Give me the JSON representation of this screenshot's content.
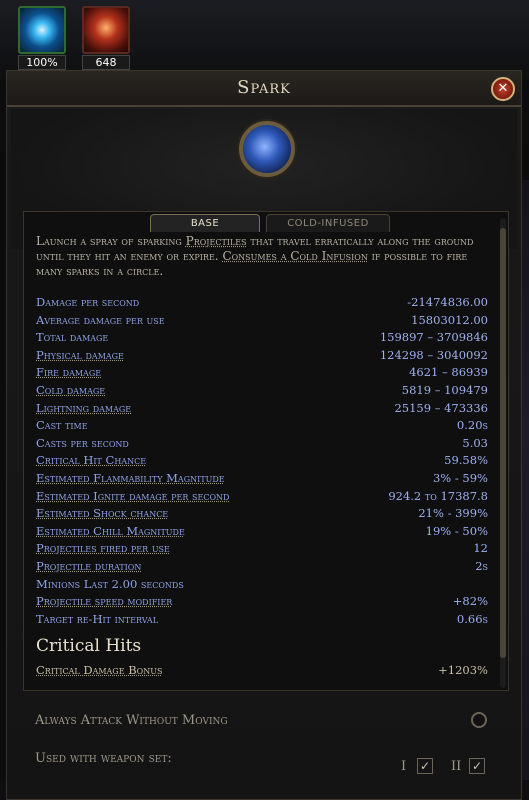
{
  "buffs": [
    {
      "label": "100%"
    },
    {
      "label": "648"
    }
  ],
  "window": {
    "title": "Spark",
    "close_glyph": "✕"
  },
  "tabs": [
    {
      "label": "BASE",
      "active": true
    },
    {
      "label": "COLD-INFUSED",
      "active": false
    }
  ],
  "description": {
    "pre": "Launch a spray of sparking ",
    "kw1": "Projectiles",
    "mid1": " that travel erratically along the ground until they hit an enemy or expire. ",
    "kw2": "Consumes a Cold Infusion",
    "post": " if possible to fire many sparks in a circle."
  },
  "stats": [
    {
      "label": "Damage per second",
      "value": "-21474836.00"
    },
    {
      "label": "Average damage per use",
      "value": "15803012.00"
    },
    {
      "label": "Total damage",
      "value": "159897 – 3709846"
    },
    {
      "label": "Physical damage",
      "value": "124298 – 3040092"
    },
    {
      "label": "Fire damage",
      "value": "4621 – 86939"
    },
    {
      "label": "Cold damage",
      "value": "5819 – 109479"
    },
    {
      "label": "Lightning damage",
      "value": "25159 – 473336"
    },
    {
      "label": "Cast time",
      "value": "0.20s"
    },
    {
      "label": "Casts per second",
      "value": "5.03"
    },
    {
      "label": "Critical Hit Chance",
      "value": "59.58%"
    },
    {
      "label": "Estimated Flammability Magnitude",
      "value": "3% - 59%"
    },
    {
      "label": "Estimated Ignite damage per second",
      "value": "924.2 to 17387.8"
    },
    {
      "label": "Estimated Shock chance",
      "value": "21% - 399%"
    },
    {
      "label": "Estimated Chill Magnitude",
      "value": "19% - 50%"
    },
    {
      "label": "Projectiles fired per use",
      "value": "12"
    },
    {
      "label": "Projectile duration",
      "value": "2s"
    },
    {
      "label": "Minions Last 2.00 seconds",
      "value": ""
    },
    {
      "label": "Projectile speed modifier",
      "value": "+82%"
    },
    {
      "label": "Target re-Hit interval",
      "value": "0.66s"
    }
  ],
  "critical_section": {
    "title": "Critical Hits",
    "label": "Critical Damage Bonus",
    "value": "+1203%"
  },
  "options": {
    "always_attack": "Always Attack Without Moving",
    "weapon_set": "Used with weapon set:",
    "set1": "I",
    "set2": "II",
    "check_glyph": "✓"
  }
}
